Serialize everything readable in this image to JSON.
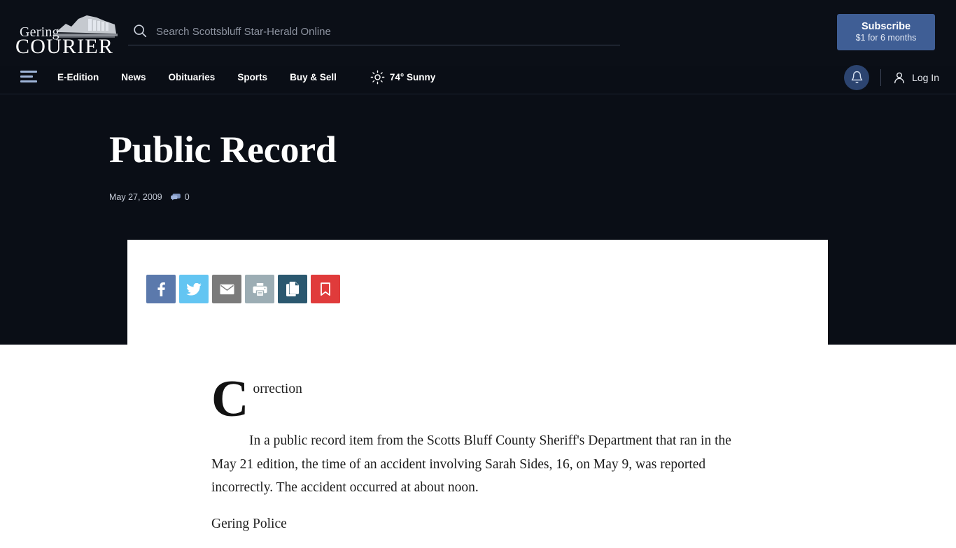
{
  "brand": {
    "name_top": "Gering",
    "name_main": "COURIER",
    "logo_alt": "Gering Courier"
  },
  "search": {
    "placeholder": "Search Scottsbluff Star-Herald Online",
    "value": "",
    "icon": "search-icon"
  },
  "subscribe": {
    "title": "Subscribe",
    "subtitle": "$1 for 6 months",
    "color": "#3f5e95"
  },
  "nav": {
    "menu_icon": "hamburger-icon",
    "items": [
      {
        "label": "E-Edition"
      },
      {
        "label": "News"
      },
      {
        "label": "Obituaries"
      },
      {
        "label": "Sports"
      },
      {
        "label": "Buy & Sell"
      }
    ],
    "weather": {
      "icon": "sun-icon",
      "label": "74° Sunny"
    },
    "notifications_icon": "bell-icon",
    "account": {
      "icon": "user-icon",
      "label": "Log In"
    }
  },
  "article": {
    "title": "Public Record",
    "date": "May 27, 2009",
    "comments_icon": "comment-bubble-icon",
    "comment_count": "0",
    "share": {
      "buttons": [
        {
          "name": "facebook",
          "label": "Facebook",
          "color": "#5b79ac"
        },
        {
          "name": "twitter",
          "label": "Twitter",
          "color": "#63c5f2"
        },
        {
          "name": "email",
          "label": "Email",
          "color": "#7b7b7b"
        },
        {
          "name": "print",
          "label": "Print",
          "color": "#9cadb4"
        },
        {
          "name": "copy",
          "label": "Copy article link",
          "color": "#2b586f"
        },
        {
          "name": "save",
          "label": "Save",
          "color": "#e03b3b"
        }
      ]
    },
    "body": {
      "dropcap": "C",
      "heading_rest": "orrection",
      "paragraph_1": "In a public record item from the Scotts Bluff County Sheriff's Department that ran in the May 21 edition, the time of an accident involving Sarah Sides, 16, on May 9, was reported incorrectly. The accident occurred at about noon.",
      "paragraph_2": "Gering Police"
    }
  },
  "colors": {
    "shell_background": "#0a0e16",
    "header_background": "#0b0f17",
    "card_background": "#ffffff",
    "accent_blue": "#3f5e95"
  }
}
